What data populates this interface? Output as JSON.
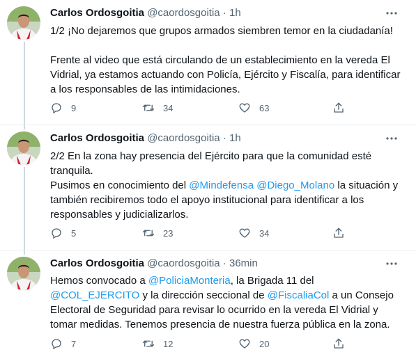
{
  "colors": {
    "link": "#1d9bf0",
    "secondary": "#536471",
    "text": "#0f1419"
  },
  "tweets": [
    {
      "author": {
        "name": "Carlos Ordosgoitia",
        "handle": "@caordosgoitia"
      },
      "separator": "·",
      "time": "1h",
      "paragraphs": [
        [
          {
            "text": "1/2 ¡No dejaremos que grupos armados siembren temor en la ciudadanía!"
          }
        ],
        [
          {
            "text": "Frente al video que está circulando de un establecimiento en la vereda El Vidrial, ya estamos actuando con Policía, Ejército y Fiscalía, para identificar a los responsables de las intimidaciones."
          }
        ]
      ],
      "actions": {
        "replies": "9",
        "retweets": "34",
        "likes": "63"
      },
      "icons": [
        "reply-icon",
        "retweet-icon",
        "like-icon",
        "share-icon",
        "more-icon"
      ]
    },
    {
      "author": {
        "name": "Carlos Ordosgoitia",
        "handle": "@caordosgoitia"
      },
      "separator": "·",
      "time": "1h",
      "paragraphs": [
        [
          {
            "text": "2/2 En la zona hay presencia del Ejército para que la comunidad esté tranquila."
          }
        ],
        [
          {
            "text": "Pusimos en conocimiento del "
          },
          {
            "text": "@Mindefensa",
            "mention": true
          },
          {
            "text": " "
          },
          {
            "text": "@Diego_Molano",
            "mention": true
          },
          {
            "text": " la situación y también recibiremos todo el apoyo institucional para identificar a los responsables y judicializarlos."
          }
        ]
      ],
      "actions": {
        "replies": "5",
        "retweets": "23",
        "likes": "34"
      }
    },
    {
      "author": {
        "name": "Carlos Ordosgoitia",
        "handle": "@caordosgoitia"
      },
      "separator": "·",
      "time": "36min",
      "paragraphs": [
        [
          {
            "text": "Hemos convocado a "
          },
          {
            "text": "@PoliciaMonteria",
            "mention": true
          },
          {
            "text": ", la Brigada 11 del "
          },
          {
            "text": "@COL_EJERCITO",
            "mention": true
          },
          {
            "text": " y la dirección seccional de "
          },
          {
            "text": "@FiscaliaCol",
            "mention": true
          },
          {
            "text": " a un Consejo Electoral de Seguridad para revisar lo ocurrido en la vereda El Vidrial y tomar medidas. Tenemos presencia de nuestra fuerza pública en la zona."
          }
        ]
      ],
      "actions": {
        "replies": "7",
        "retweets": "12",
        "likes": "20"
      }
    }
  ]
}
